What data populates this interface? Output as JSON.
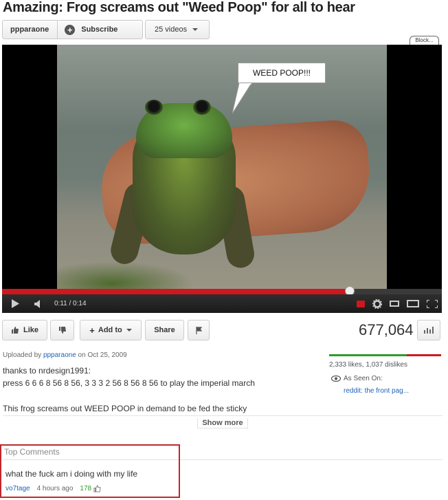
{
  "title": "Amazing: Frog screams out \"Weed Poop\" for all to hear",
  "channel": {
    "name": "ppparaone",
    "subscribe_label": "Subscribe",
    "videos_label": "25 videos"
  },
  "block_label": "Block...",
  "video": {
    "speech_bubble": "WEED POOP!!!",
    "time_display": "0:11 / 0:14",
    "progress": 0.79
  },
  "actions": {
    "like_label": "Like",
    "add_to_label": "Add to",
    "share_label": "Share"
  },
  "views": "677,064",
  "uploaded": {
    "prefix": "Uploaded by",
    "user": "ppparaone",
    "date_text": "on Oct 25, 2009"
  },
  "description": {
    "line1": "thanks to nrdesign1991:",
    "line2": "press 6 6 6 8 56 8 56, 3 3 3 2 56 8 56 8 56 to play the imperial march",
    "line3": "This frog screams out WEED POOP in demand to be fed the sticky"
  },
  "ratings": {
    "likes_text": "2,333 likes, 1,037 dislikes",
    "like_ratio": 0.692
  },
  "seen_on": {
    "label": "As Seen On:",
    "link": "reddit: the front pag..."
  },
  "show_more_label": "Show more",
  "top_comments": {
    "title": "Top Comments",
    "comment_text": "what the fuck am i doing with my life",
    "author": "vo7tage",
    "time": "4 hours ago",
    "votes": "178"
  },
  "colors": {
    "progress_red": "#cc181e",
    "like_green": "#2f9c27",
    "link_blue": "#1c62b9",
    "highlight_red": "#c0272d"
  }
}
